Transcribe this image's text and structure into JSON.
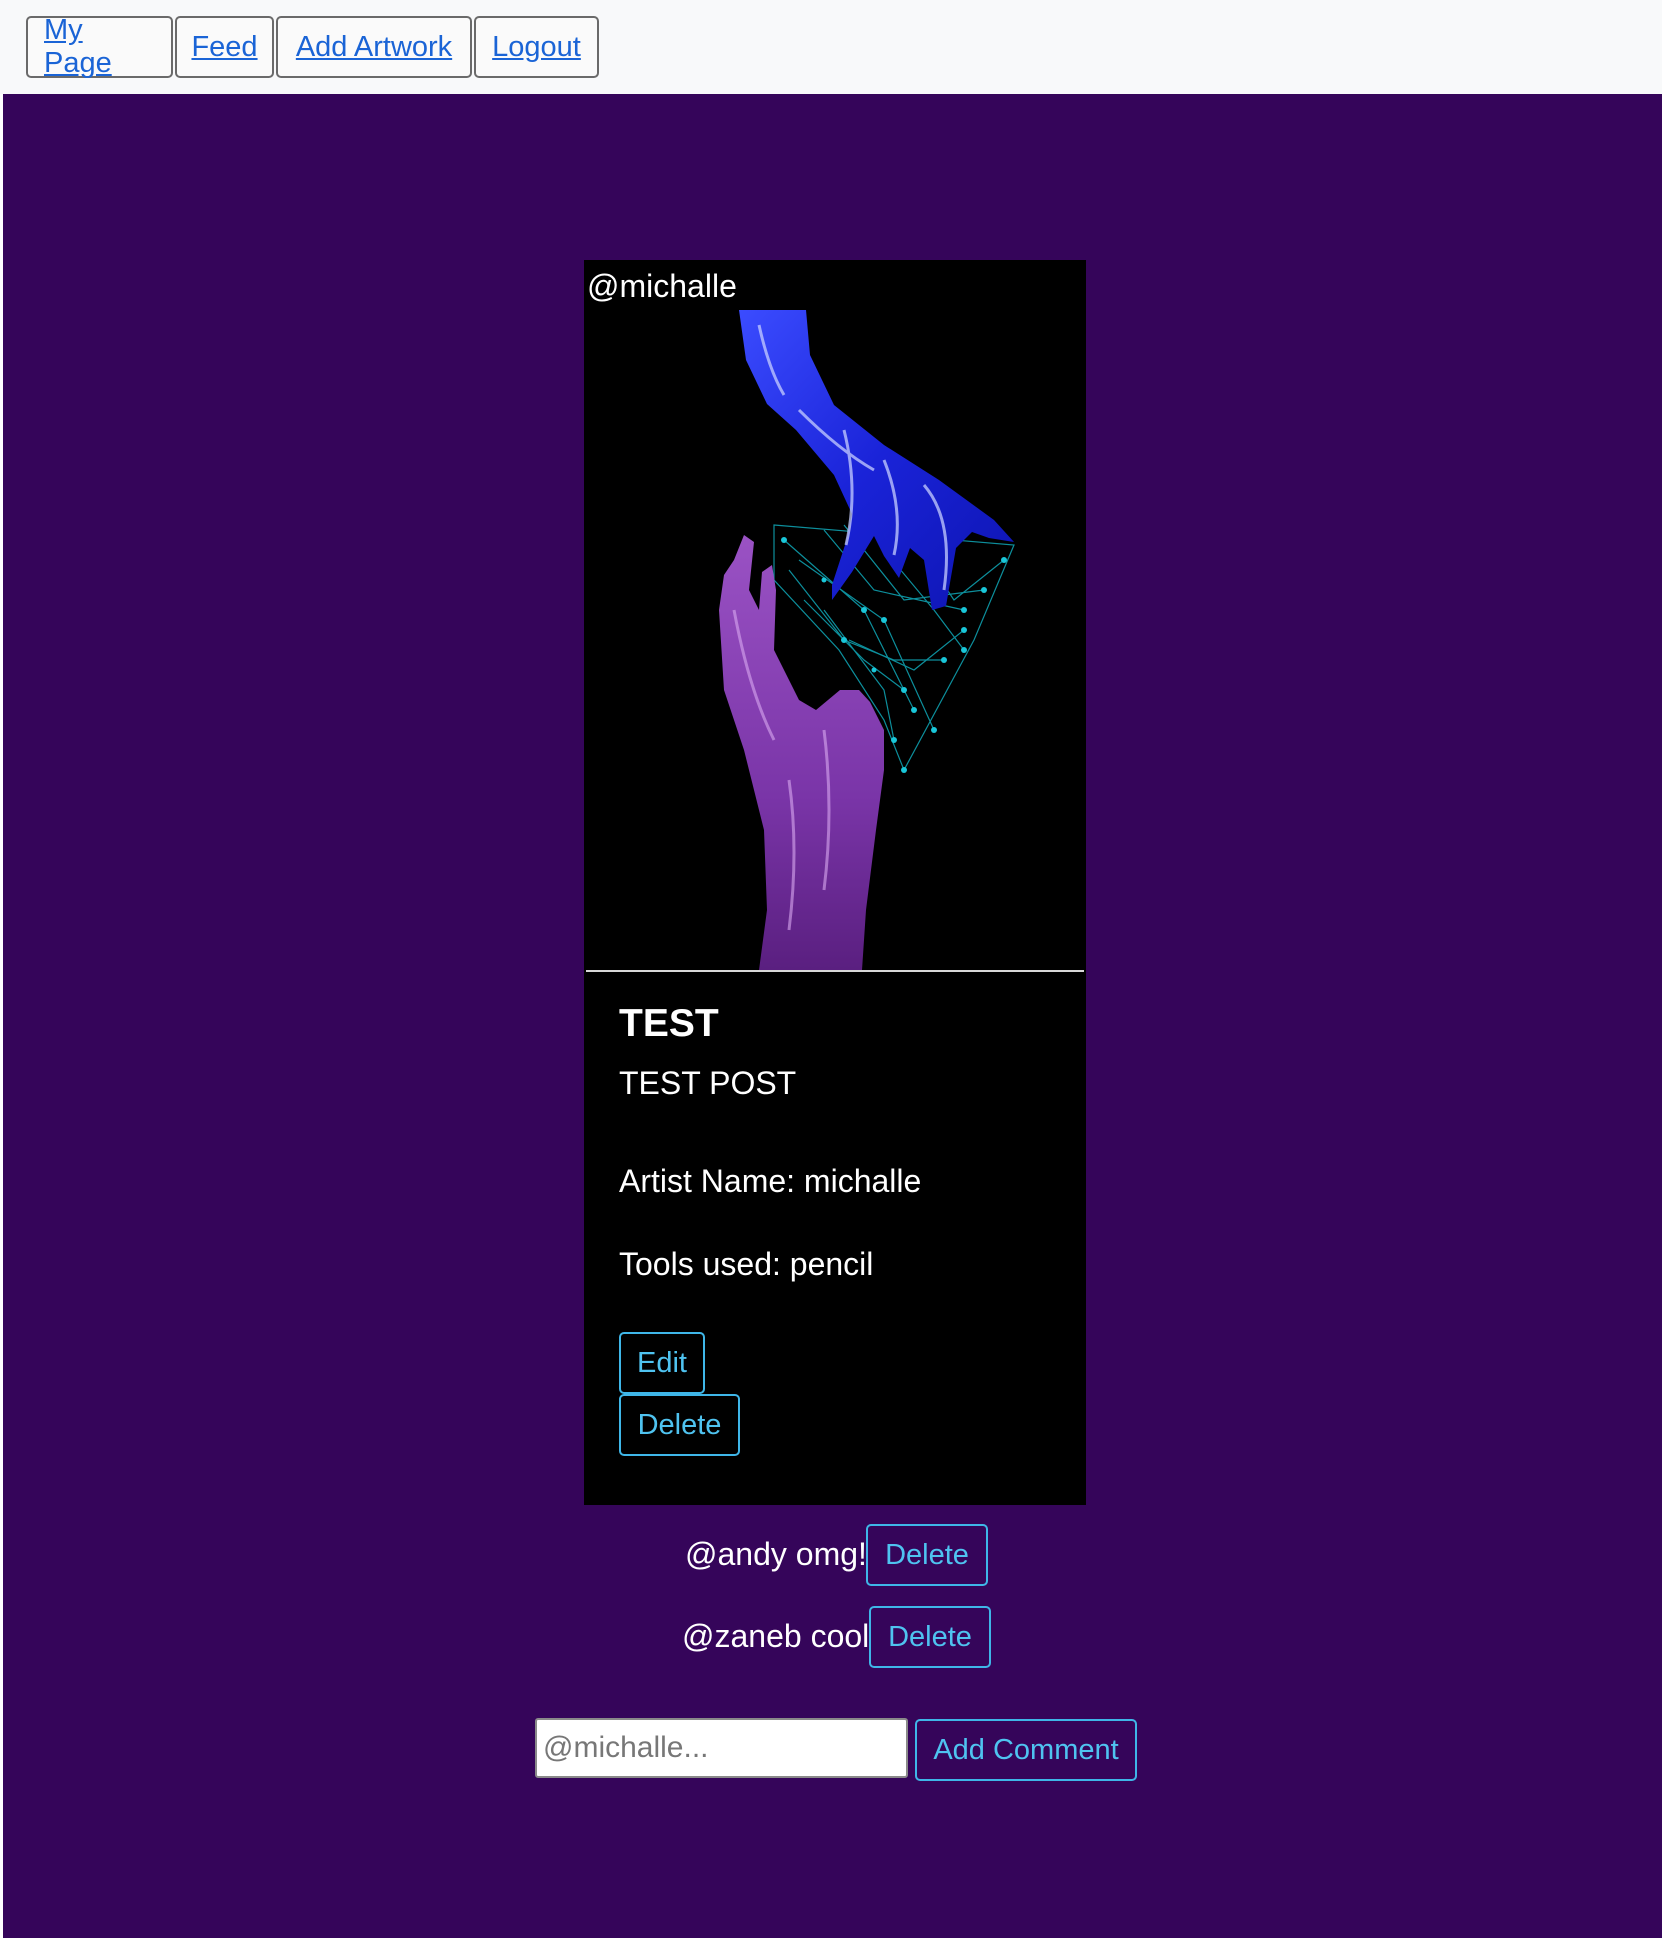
{
  "nav": {
    "items": [
      {
        "label": "My Page"
      },
      {
        "label": "Feed"
      },
      {
        "label": "Add Artwork"
      },
      {
        "label": "Logout"
      }
    ]
  },
  "post": {
    "username": "@michalle",
    "title": "TEST",
    "description": "TEST POST",
    "artist_line": "Artist Name: michalle",
    "tools_line": "Tools used: pencil",
    "edit_label": "Edit",
    "delete_label": "Delete"
  },
  "comments": [
    {
      "text": "@andy omg!",
      "delete_label": "Delete"
    },
    {
      "text": "@zaneb cool",
      "delete_label": "Delete"
    }
  ],
  "comment_form": {
    "placeholder": "@michalle...",
    "submit_label": "Add Comment"
  },
  "colors": {
    "page_bg": "#35055a",
    "card_bg": "#000000",
    "accent": "#4fc3f0",
    "link": "#1a64d6"
  }
}
